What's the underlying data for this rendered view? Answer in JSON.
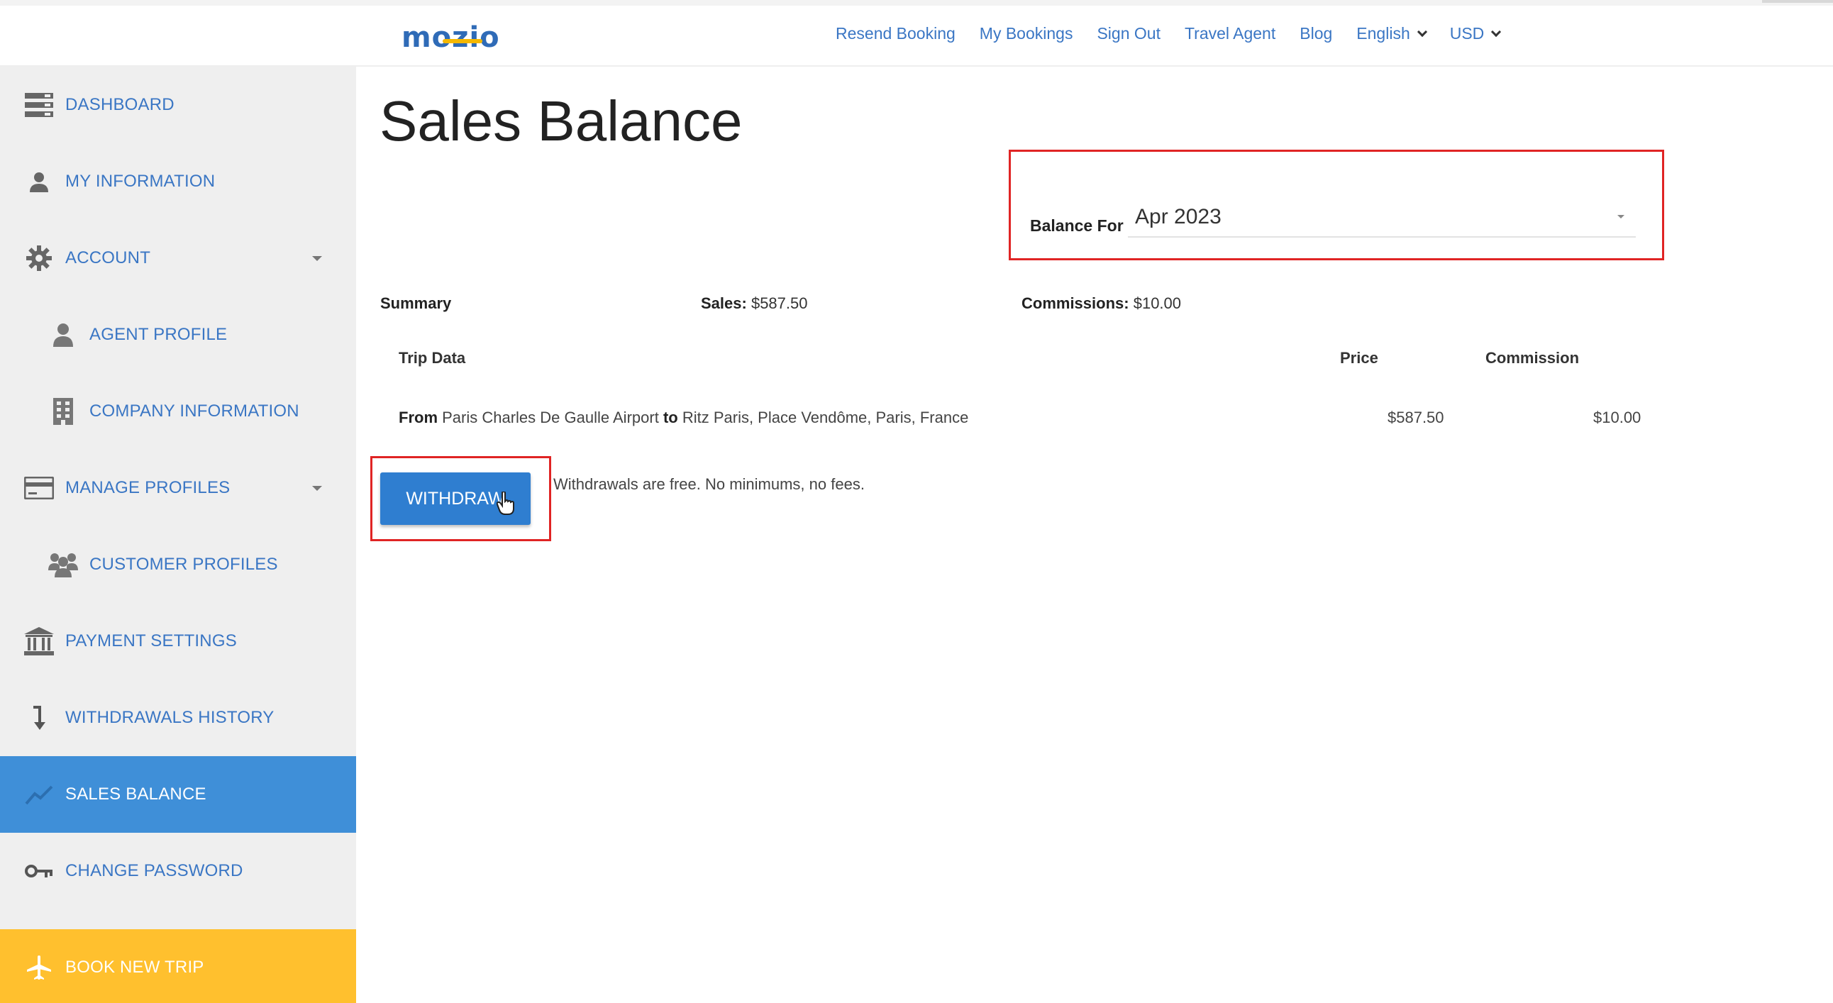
{
  "header": {
    "logo": "mozio",
    "nav": [
      {
        "label": "Resend Booking"
      },
      {
        "label": "My Bookings"
      },
      {
        "label": "Sign Out"
      },
      {
        "label": "Travel Agent"
      },
      {
        "label": "Blog"
      },
      {
        "label": "English",
        "dropdown": true
      },
      {
        "label": "USD",
        "dropdown": true
      }
    ]
  },
  "sidebar": {
    "items": [
      {
        "label": "DASHBOARD",
        "icon": "dashboard-icon"
      },
      {
        "label": "MY INFORMATION",
        "icon": "person-icon"
      },
      {
        "label": "ACCOUNT",
        "icon": "gear-icon",
        "expandable": true
      },
      {
        "label": "AGENT PROFILE",
        "icon": "person-icon",
        "sub": true
      },
      {
        "label": "COMPANY INFORMATION",
        "icon": "building-icon",
        "sub": true
      },
      {
        "label": "MANAGE PROFILES",
        "icon": "card-icon",
        "expandable": true
      },
      {
        "label": "CUSTOMER PROFILES",
        "icon": "group-icon",
        "sub": true
      },
      {
        "label": "PAYMENT SETTINGS",
        "icon": "bank-icon"
      },
      {
        "label": "WITHDRAWALS HISTORY",
        "icon": "arrow-down-icon"
      },
      {
        "label": "SALES BALANCE",
        "icon": "chart-icon",
        "active": true
      },
      {
        "label": "CHANGE PASSWORD",
        "icon": "key-icon"
      },
      {
        "label": "BOOK NEW TRIP",
        "icon": "plane-icon",
        "highlight": "#ffc02e"
      }
    ]
  },
  "main": {
    "title": "Sales Balance",
    "balance_for": {
      "label": "Balance For",
      "value": "Apr 2023"
    },
    "summary": {
      "label": "Summary",
      "sales_label": "Sales:",
      "sales_value": "$587.50",
      "commissions_label": "Commissions:",
      "commissions_value": "$10.00"
    },
    "table": {
      "headers": {
        "trip": "Trip Data",
        "price": "Price",
        "commission": "Commission"
      },
      "rows": [
        {
          "from_label": "From",
          "from": "Paris Charles De Gaulle Airport",
          "to_label": "to",
          "to": "Ritz Paris, Place Vendôme, Paris, France",
          "price": "$587.50",
          "commission": "$10.00"
        }
      ]
    },
    "withdraw": {
      "button_label": "WITHDRAW",
      "note": "Withdrawals are free. No minimums, no fees."
    }
  },
  "colors": {
    "brand_blue": "#2f6bb7",
    "link_blue": "#3a76c4",
    "active_bg": "#3f8fd8",
    "book_bg": "#ffc02e",
    "button_blue": "#2f7ed0",
    "highlight_red": "#e02424"
  }
}
